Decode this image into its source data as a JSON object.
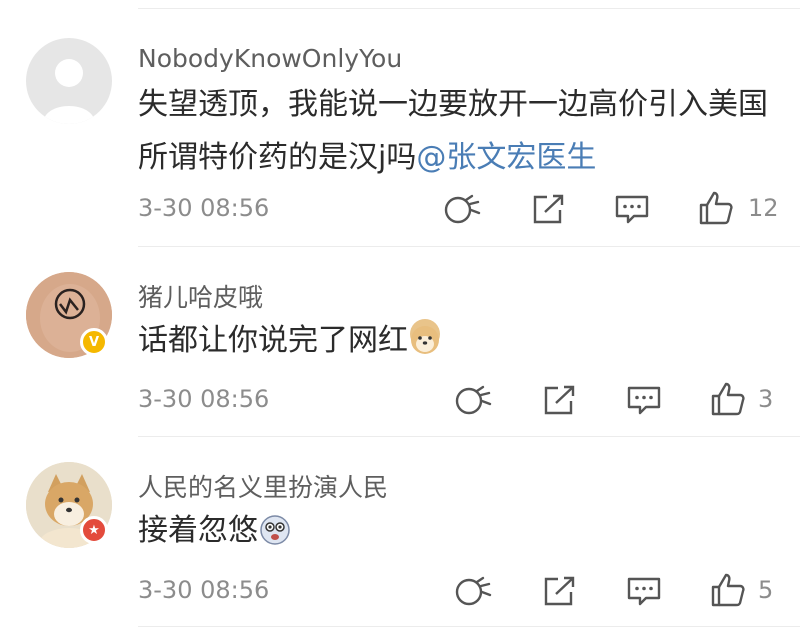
{
  "comments": [
    {
      "username": "NobodyKnowOnlyYou",
      "text": "失望透顶，我能说一边要放开一边高价引入美国所谓特价药的是汉j吗",
      "mention": "@张文宏医生",
      "timestamp": "3-30 08:56",
      "likes": "12",
      "avatar": "default-avatar"
    },
    {
      "username": "猪儿哈皮哦",
      "text": "话都让你说完了网红",
      "emoji": "doge-emoji",
      "timestamp": "3-30 08:56",
      "likes": "3",
      "avatar": "tattoo-avatar",
      "badge": "V"
    },
    {
      "username": "人民的名义里扮演人民",
      "text": "接着忽悠",
      "emoji": "dizzy-face-emoji",
      "timestamp": "3-30 08:56",
      "likes": "5",
      "avatar": "shiba-avatar",
      "badge": "★"
    }
  ],
  "actions": [
    "share-icon",
    "forward-icon",
    "reply-icon",
    "like-icon"
  ],
  "colors": {
    "mention": "#4a7db5",
    "badge_gold": "#f5b800",
    "badge_red": "#e34b3c"
  }
}
